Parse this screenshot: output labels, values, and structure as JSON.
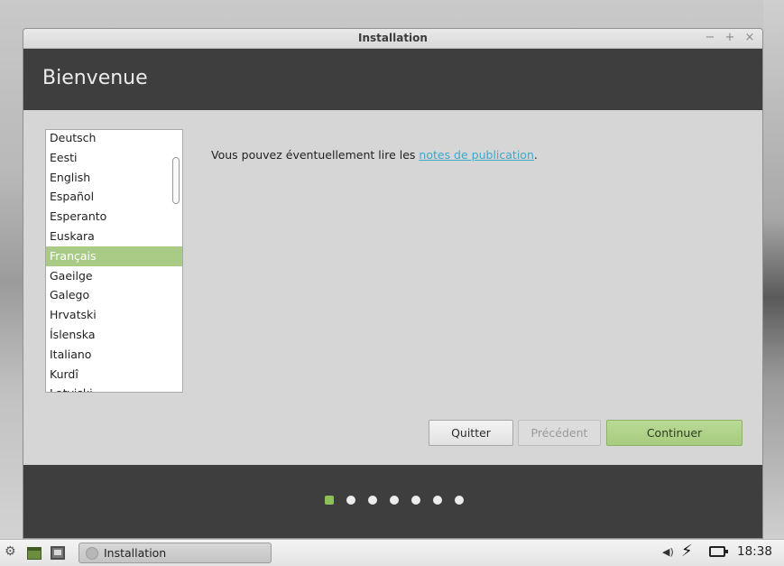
{
  "window": {
    "title": "Installation",
    "controls": {
      "minimize": "−",
      "maximize": "+",
      "close": "×"
    }
  },
  "header": {
    "title": "Bienvenue"
  },
  "languages": {
    "items": [
      "Deutsch",
      "Eesti",
      "English",
      "Español",
      "Esperanto",
      "Euskara",
      "Français",
      "Gaeilge",
      "Galego",
      "Hrvatski",
      "Íslenska",
      "Italiano",
      "Kurdî",
      "Latviski"
    ],
    "selected": "Français"
  },
  "info": {
    "text_before": "Vous pouvez éventuellement lire les ",
    "link_text": "notes de publication",
    "text_after": "."
  },
  "buttons": {
    "quit_label": "Quitter",
    "previous_label": "Précédent",
    "continue_label": "Continuer"
  },
  "progress": {
    "total_steps": 7,
    "current_step": 1
  },
  "taskbar": {
    "task_label": "Installation",
    "clock": "18:38",
    "icons": [
      "menu-icon",
      "show-desktop-icon",
      "terminal-icon",
      "volume-icon",
      "network-icon",
      "battery-icon"
    ]
  },
  "colors": {
    "accent": "#a9cb85",
    "header_bg": "#3e3e3e",
    "link": "#3fa8c8",
    "step_active": "#8fbf5a"
  }
}
